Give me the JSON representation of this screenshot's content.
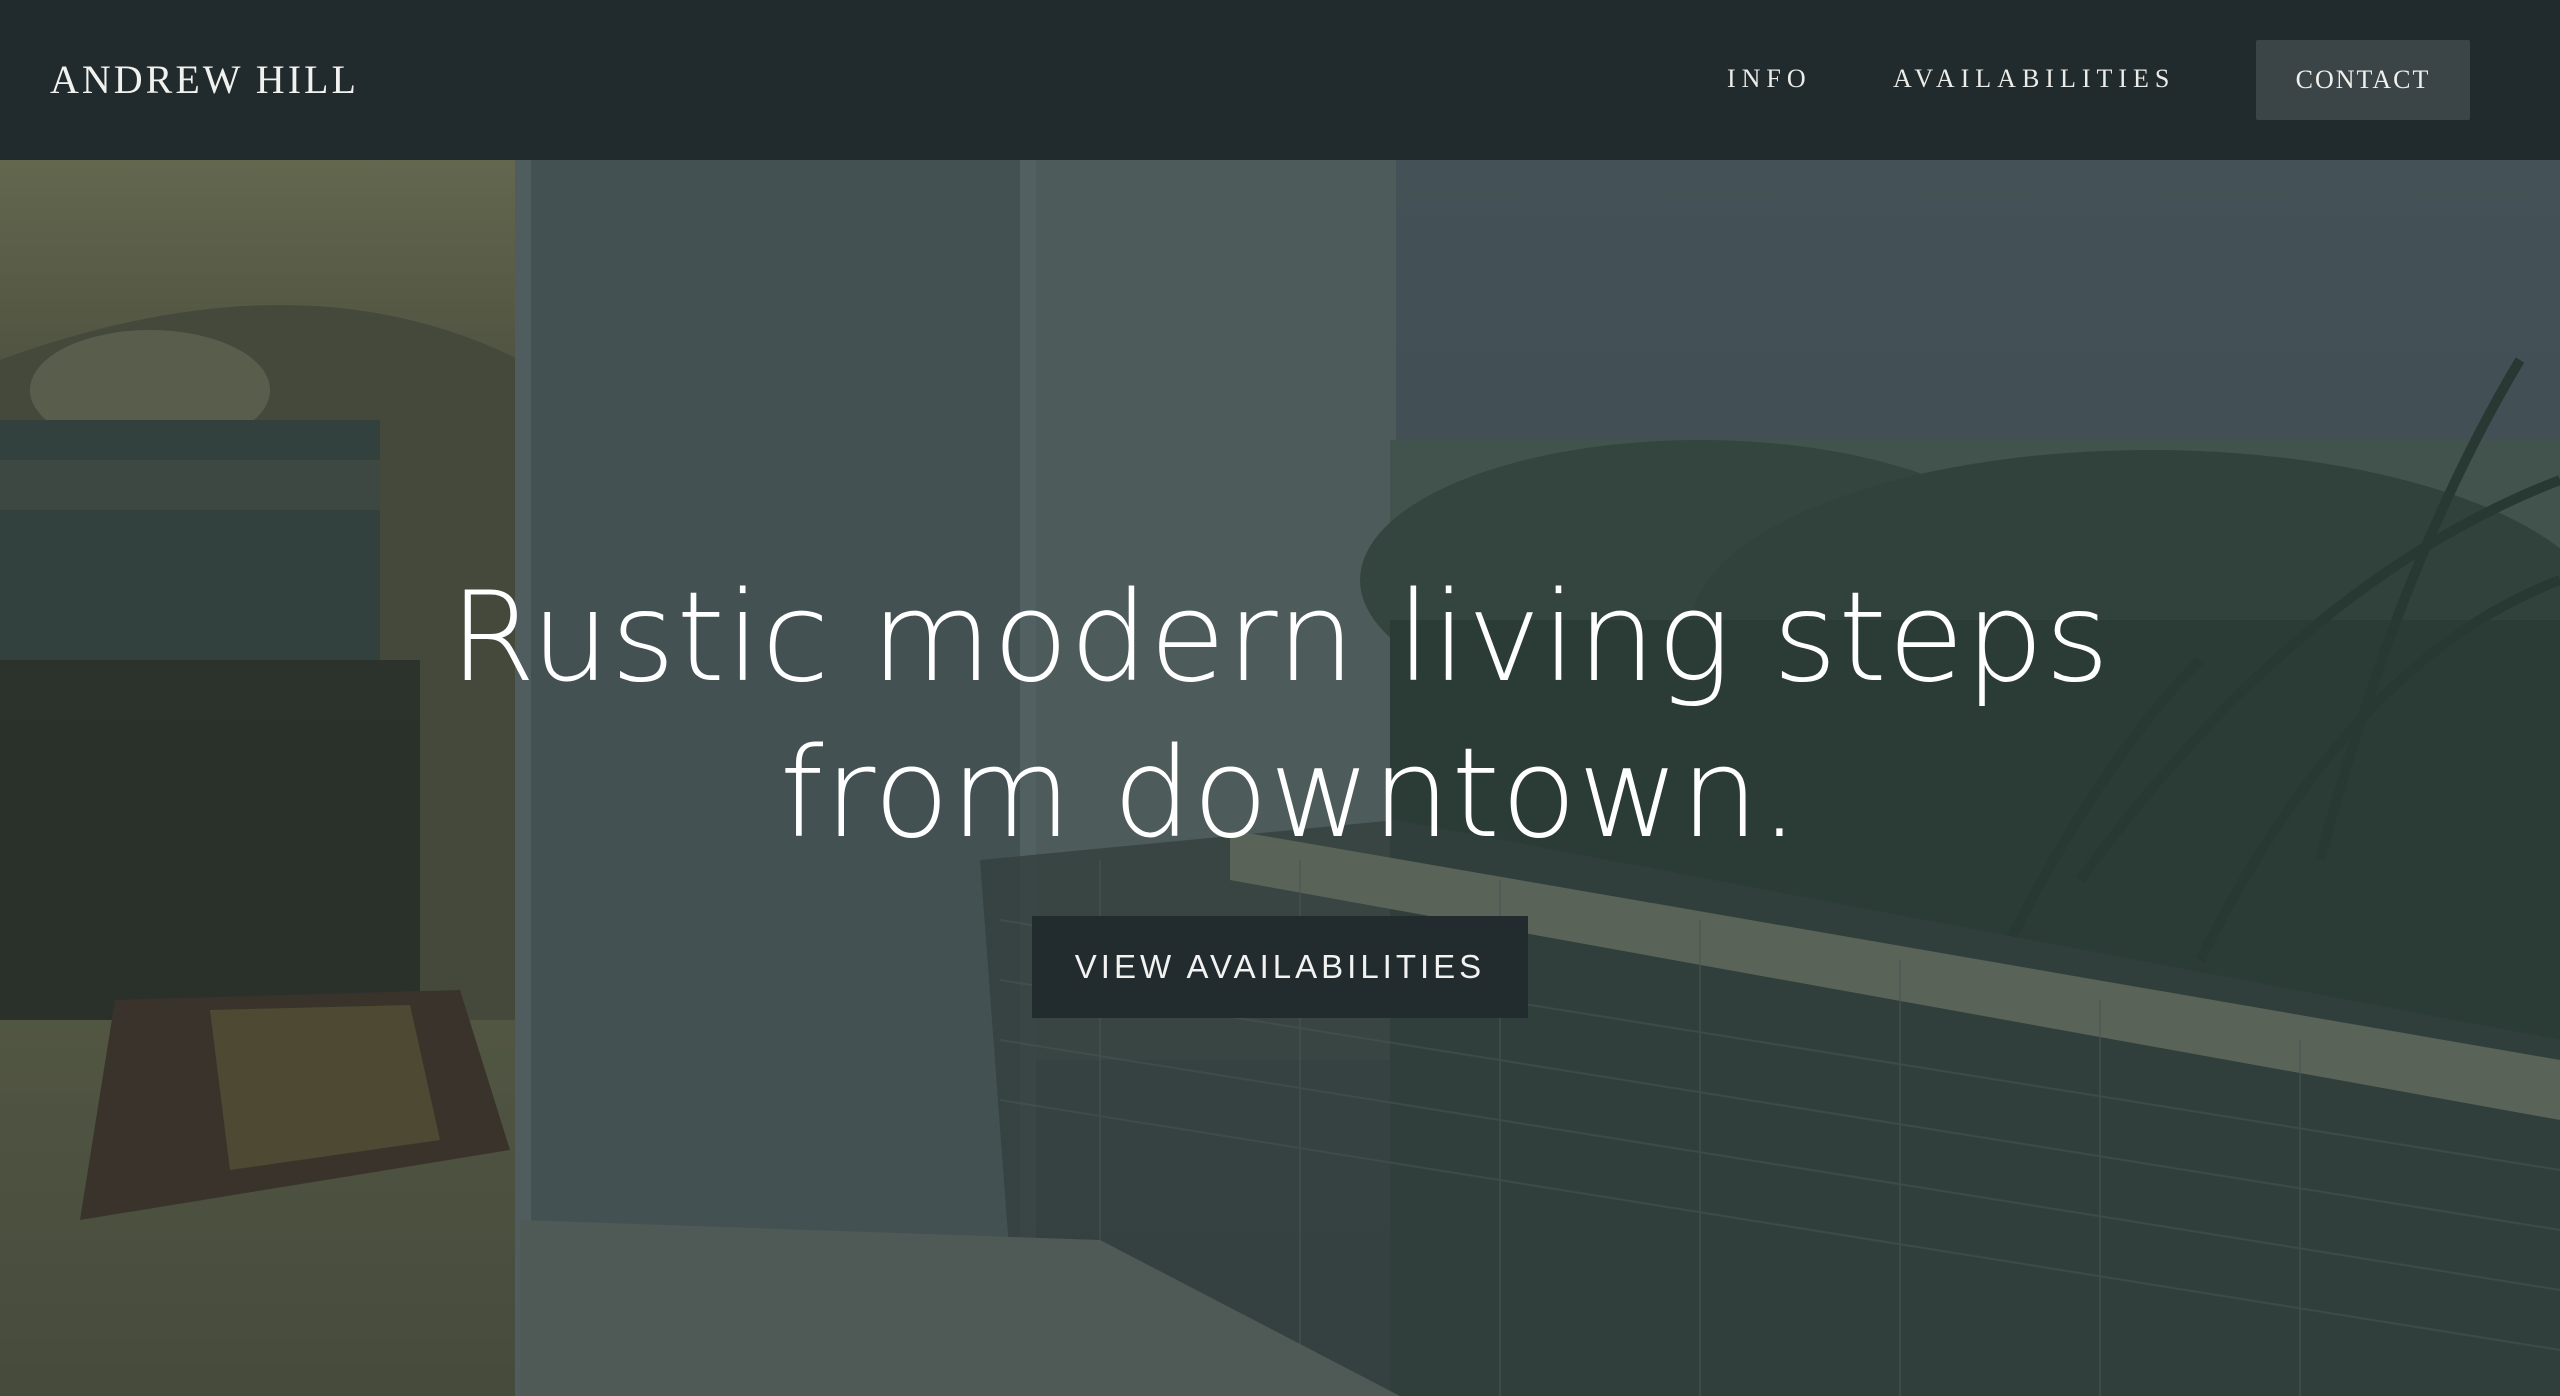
{
  "header": {
    "brand": "ANDREW HILL",
    "nav": [
      {
        "label": "INFO"
      },
      {
        "label": "AVAILABILITIES"
      }
    ],
    "contact_label": "CONTACT"
  },
  "hero": {
    "title_line1": "Rustic modern living steps",
    "title_line2": "from downtown.",
    "cta_label": "VIEW AVAILABILITIES",
    "background_image": "balcony-view-photo"
  },
  "colors": {
    "header_bg": "#212b2d",
    "contact_bg": "#3b4447",
    "cta_bg": "#222b2d",
    "text": "#ffffff"
  }
}
